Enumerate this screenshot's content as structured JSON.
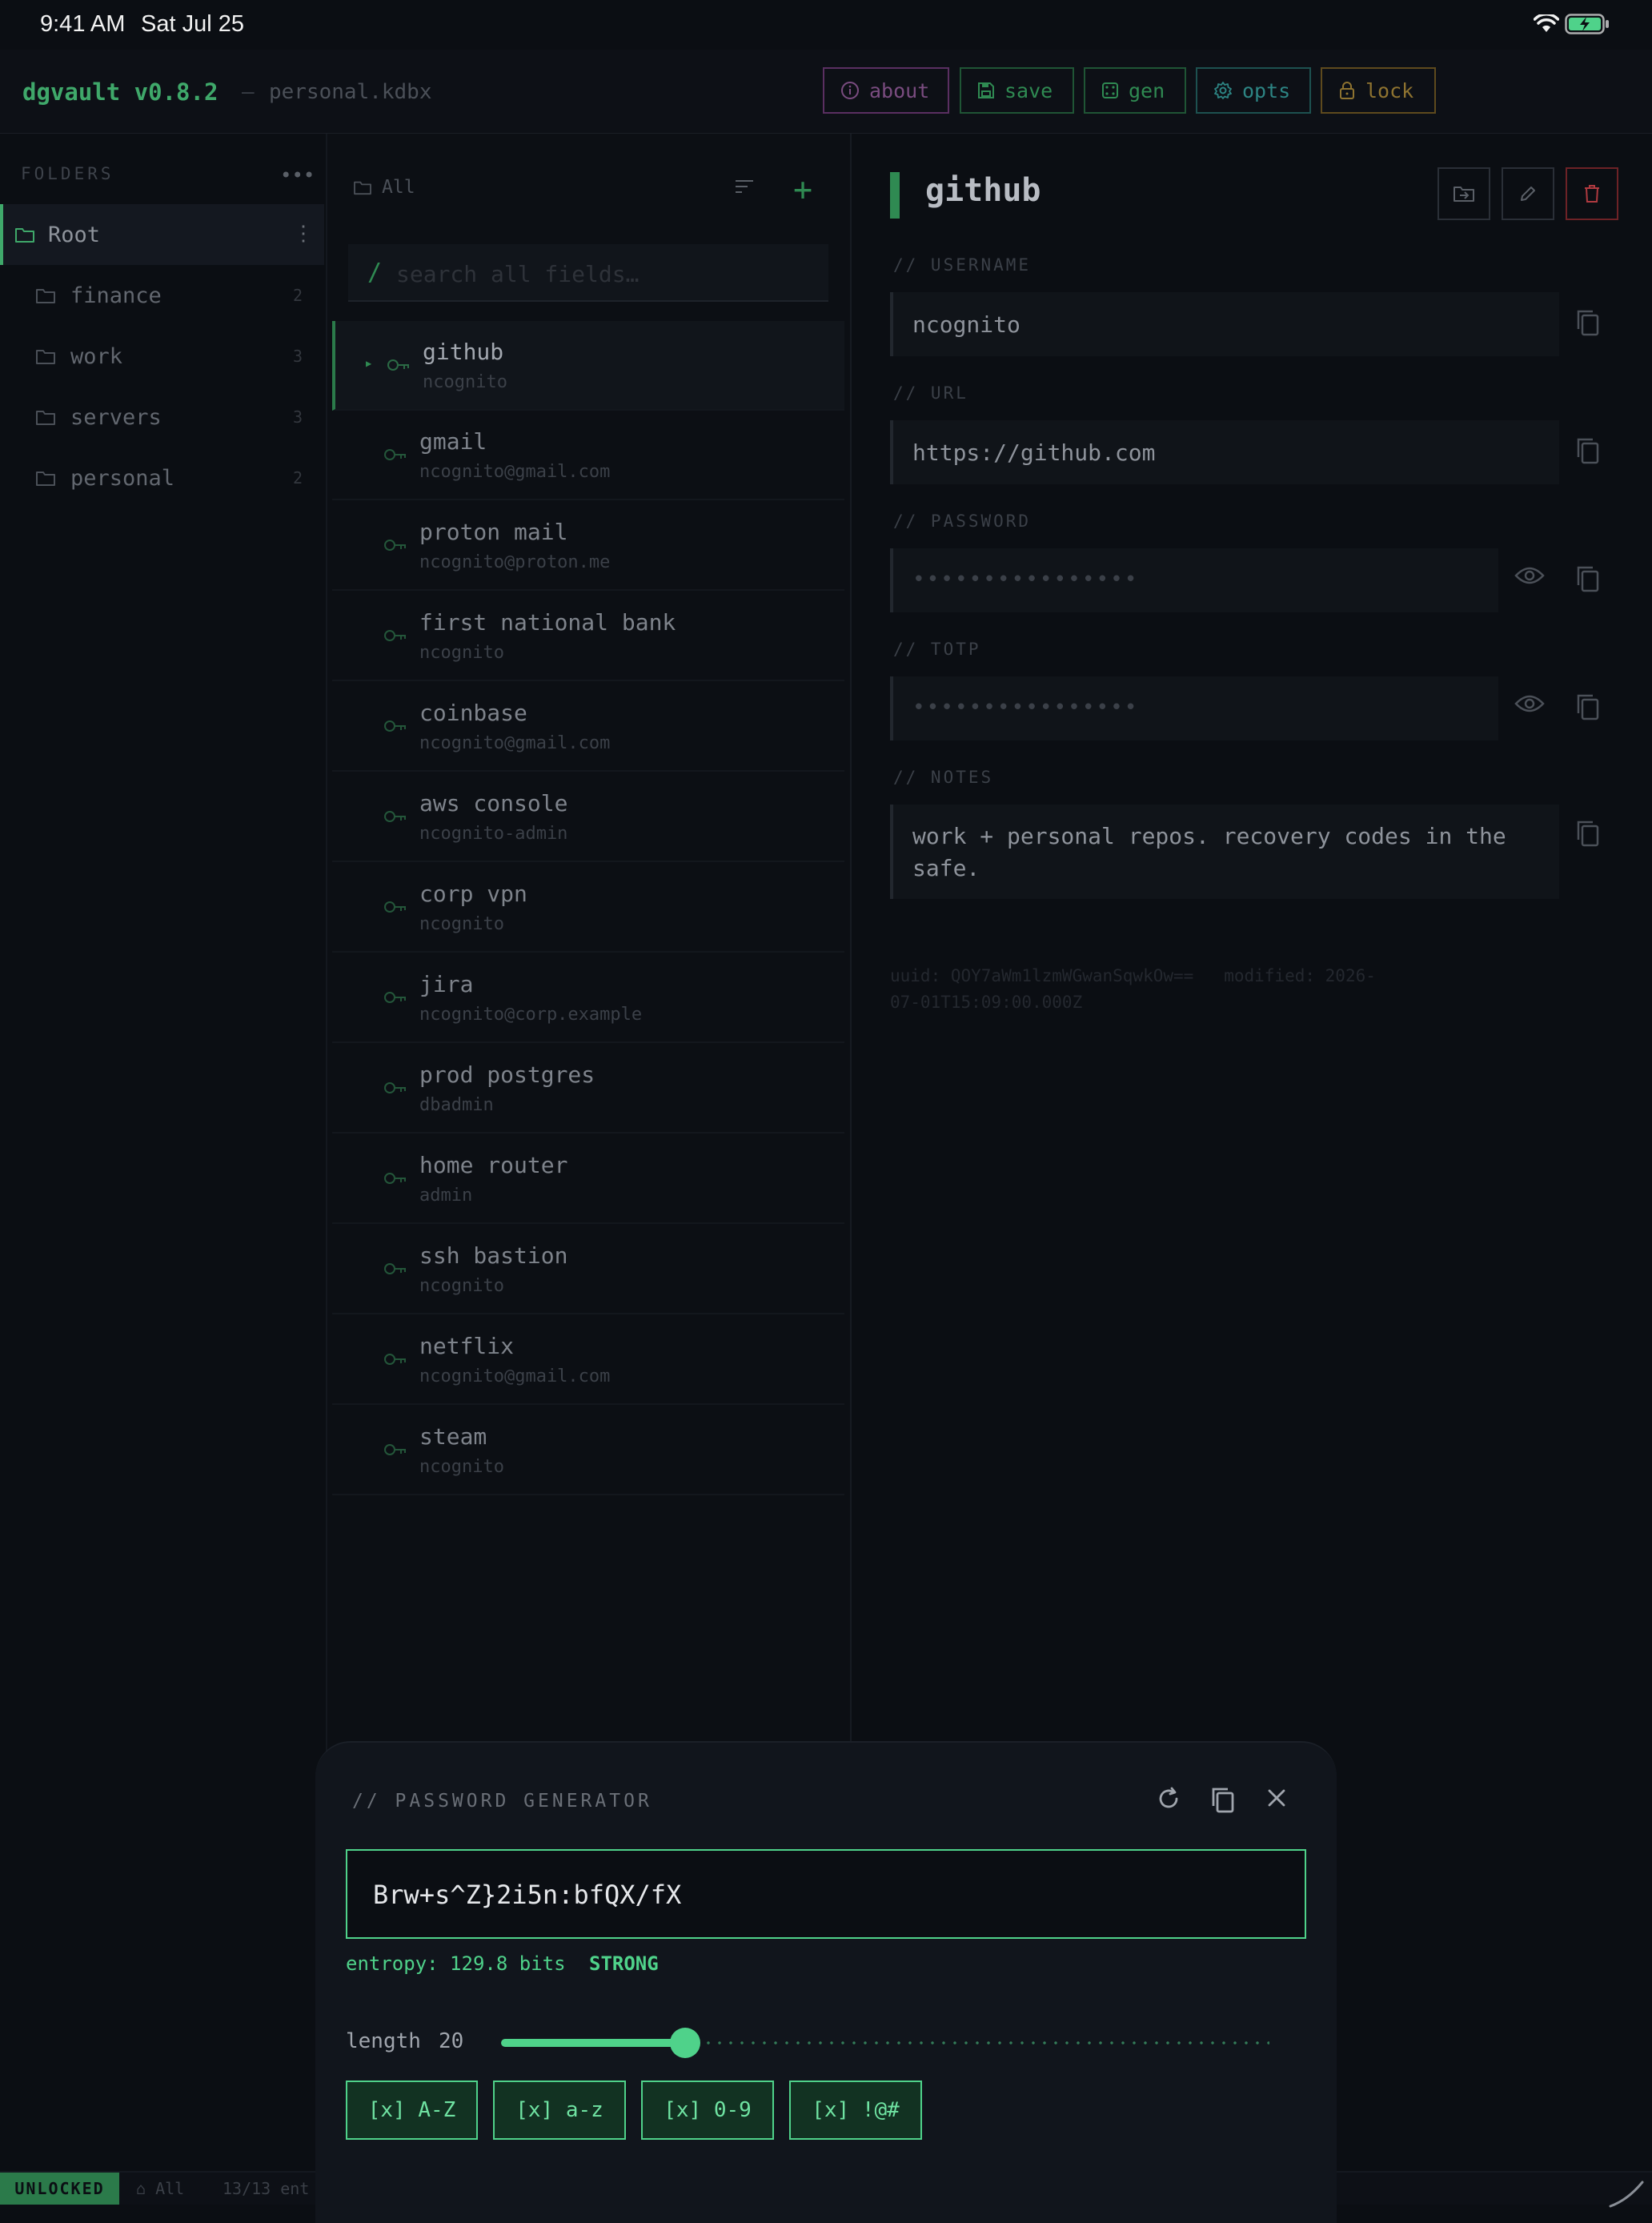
{
  "status_bar": {
    "time": "9:41 AM",
    "date": "Sat Jul 25"
  },
  "header": {
    "app_title": "dgvault v0.8.2",
    "separator": "—",
    "file_name": "personal.kdbx",
    "buttons": {
      "about": "about",
      "save": "save",
      "gen": "gen",
      "opts": "opts",
      "lock": "lock"
    },
    "colors": {
      "about": "#7a4c80",
      "save": "#2f8a52",
      "gen": "#2f8a52",
      "opts": "#2d8584",
      "lock": "#8e7330"
    }
  },
  "sidebar": {
    "title": "FOLDERS",
    "more_icon": "more-horizontal-icon",
    "folders": [
      {
        "label": "Root",
        "count": "",
        "selected": true
      },
      {
        "label": "finance",
        "count": "2"
      },
      {
        "label": "work",
        "count": "3"
      },
      {
        "label": "servers",
        "count": "3"
      },
      {
        "label": "personal",
        "count": "2"
      }
    ]
  },
  "list": {
    "current_folder": "All",
    "search_prefix": "/",
    "search_placeholder": "search all fields…",
    "entries": [
      {
        "name": "github",
        "user": "ncognito",
        "selected": true
      },
      {
        "name": "gmail",
        "user": "ncognito@gmail.com"
      },
      {
        "name": "proton mail",
        "user": "ncognito@proton.me"
      },
      {
        "name": "first national bank",
        "user": "ncognito"
      },
      {
        "name": "coinbase",
        "user": "ncognito@gmail.com"
      },
      {
        "name": "aws console",
        "user": "ncognito-admin"
      },
      {
        "name": "corp vpn",
        "user": "ncognito"
      },
      {
        "name": "jira",
        "user": "ncognito@corp.example"
      },
      {
        "name": "prod postgres",
        "user": "dbadmin"
      },
      {
        "name": "home router",
        "user": "admin"
      },
      {
        "name": "ssh bastion",
        "user": "ncognito"
      },
      {
        "name": "netflix",
        "user": "ncognito@gmail.com"
      },
      {
        "name": "steam",
        "user": "ncognito"
      }
    ]
  },
  "detail": {
    "title": "github",
    "fields": {
      "username": {
        "label": "// USERNAME",
        "value": "ncognito"
      },
      "url": {
        "label": "// URL",
        "value": "https://github.com"
      },
      "password": {
        "label": "// PASSWORD",
        "masked": "••••••••••••••••"
      },
      "totp": {
        "label": "// TOTP",
        "masked": "••••••••••••••••"
      },
      "notes": {
        "label": "// NOTES",
        "value": "work + personal repos. recovery codes in the safe."
      }
    },
    "meta": {
      "uuid": "uuid: QOY7aWm1lzmWGwanSqwkOw==",
      "modified": "modified: 2026-07-01T15:09:00.000Z"
    }
  },
  "footer": {
    "status": "UNLOCKED",
    "folder": "⌂ All",
    "count": "13/13 ent"
  },
  "generator": {
    "title": "// PASSWORD GENERATOR",
    "password": "Brw+s^Z}2i5n:bfQX/fX",
    "entropy": "entropy: 129.8 bits",
    "strength": "STRONG",
    "length_label": "length",
    "length": "20",
    "length_fraction": 0.24,
    "options": [
      "[x] A-Z",
      "[x] a-z",
      "[x] 0-9",
      "[x] !@#"
    ],
    "accent_color": "#4fd28a"
  }
}
